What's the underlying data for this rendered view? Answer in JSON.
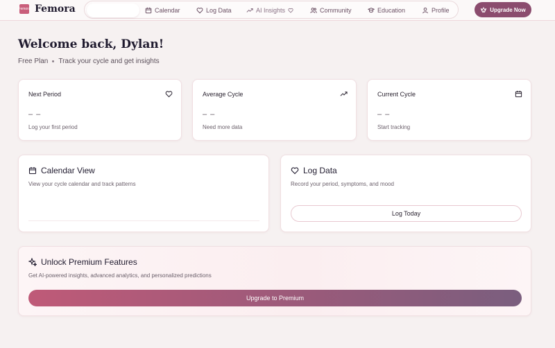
{
  "brand": {
    "name": "Femora",
    "logo_text": "Femora"
  },
  "nav": {
    "items": [
      {
        "label": "Calendar",
        "icon": "calendar-icon"
      },
      {
        "label": "Log Data",
        "icon": "heart-icon"
      },
      {
        "label": "AI Insights",
        "icon": "trending-up-icon"
      },
      {
        "label": "Community",
        "icon": "users-icon"
      },
      {
        "label": "Education",
        "icon": "book-icon"
      },
      {
        "label": "Profile",
        "icon": "user-icon"
      }
    ],
    "upgrade_label": "Upgrade Now"
  },
  "welcome": {
    "title": "Welcome back, Dylan!",
    "plan": "Free Plan",
    "tagline": "Track your cycle and get insights"
  },
  "stats": [
    {
      "title": "Next Period",
      "value": "– –",
      "sub": "Log your first period",
      "icon": "heart-icon"
    },
    {
      "title": "Average Cycle",
      "value": "– –",
      "sub": "Need more data",
      "icon": "trending-up-icon"
    },
    {
      "title": "Current Cycle",
      "value": "– –",
      "sub": "Start tracking",
      "icon": "calendar-icon"
    }
  ],
  "calendar_card": {
    "title": "Calendar View",
    "desc": "View your cycle calendar and track patterns"
  },
  "log_card": {
    "title": "Log Data",
    "desc": "Record your period, symptoms, and mood",
    "button": "Log Today"
  },
  "premium": {
    "title": "Unlock Premium Features",
    "desc": "Get AI-powered insights, advanced analytics, and personalized predictions",
    "button": "Upgrade to Premium"
  },
  "colors": {
    "accent": "#8b4c6e",
    "brand_pink": "#c95e7b",
    "background": "#f6f1f1"
  }
}
